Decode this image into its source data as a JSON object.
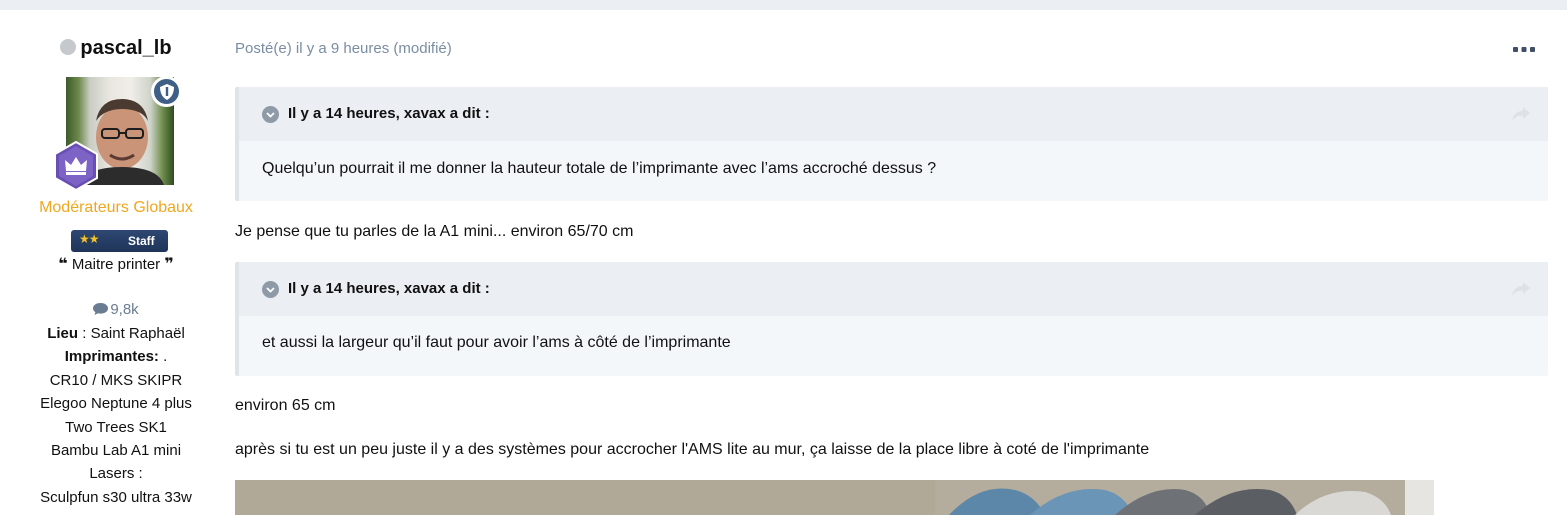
{
  "author": {
    "name": "pascal_lb",
    "status_icon": "offline-dot-icon",
    "group": "Modérateurs Globaux",
    "staff_badge": "Staff",
    "staff_stars": "★★",
    "title_open_quote": "❝",
    "title": "Maitre printer",
    "title_close_quote": "❞",
    "post_count": "9,8k",
    "location_label": "Lieu",
    "location_sep": " : ",
    "location_value": "Saint Raphaël",
    "printers_label": "Imprimantes:",
    "printers_suffix": " .",
    "printers": [
      "CR10 / MKS SKIPR",
      "Elegoo Neptune 4 plus",
      "Two Trees SK1",
      "Bambu Lab A1 mini"
    ],
    "lasers_label": "Lasers :",
    "lasers": [
      "Sculpfun s30 ultra 33w"
    ]
  },
  "post": {
    "meta": "Posté(e) il y a 9 heures (modifié)",
    "quotes": [
      {
        "cite": "Il y a 14 heures, xavax a dit :",
        "text": "Quelqu’un pourrait il me donner la hauteur totale de l’imprimante avec l’ams accroché dessus ?"
      },
      {
        "cite": "Il y a 14 heures, xavax a dit :",
        "text": "et aussi la largeur qu’il faut pour avoir l’ams à côté de l’imprimante"
      }
    ],
    "reply_1": "Je pense que tu parles de la A1 mini... environ 65/70 cm",
    "reply_2": "environ 65 cm",
    "reply_3": "après si tu est un peu juste il y a des systèmes pour accrocher l'AMS lite au mur, ça laisse de la place libre à coté de l'imprimante"
  },
  "colors": {
    "rank": "#f0a71f",
    "meta": "#7a8da3",
    "staff_badge": "#1f3458",
    "quote_bg": "#f4f7fa"
  }
}
